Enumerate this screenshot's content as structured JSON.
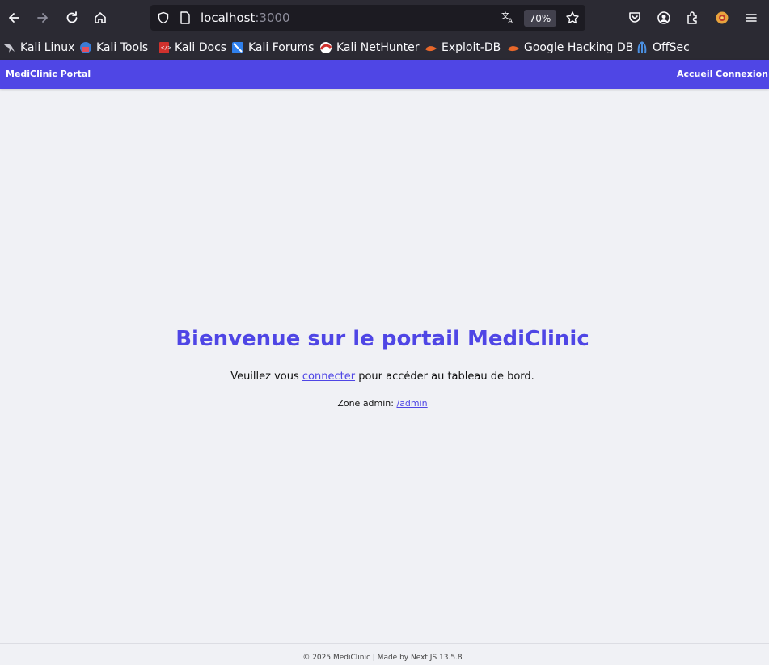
{
  "browser": {
    "url_host": "localhost",
    "url_port": ":3000",
    "zoom": "70%",
    "bookmarks": [
      {
        "label": "Kali Linux",
        "icon": "kali-dragon-icon"
      },
      {
        "label": "Kali Tools",
        "icon": "kali-tools-icon"
      },
      {
        "label": "Kali Docs",
        "icon": "kali-docs-icon"
      },
      {
        "label": "Kali Forums",
        "icon": "kali-forums-icon"
      },
      {
        "label": "Kali NetHunter",
        "icon": "nethunter-icon"
      },
      {
        "label": "Exploit-DB",
        "icon": "exploit-db-icon"
      },
      {
        "label": "Google Hacking DB",
        "icon": "ghdb-icon"
      },
      {
        "label": "OffSec",
        "icon": "offsec-icon"
      }
    ]
  },
  "app": {
    "brand": "MediClinic Portal",
    "nav": {
      "home": "Accueil",
      "login": "Connexion"
    },
    "accent_color": "#4f46e5"
  },
  "main": {
    "title": "Bienvenue sur le portail MediClinic",
    "intro_before": "Veuillez vous ",
    "intro_link": "connecter",
    "intro_after": " pour accéder au tableau de bord.",
    "admin_label": "Zone admin: ",
    "admin_link": "/admin"
  },
  "footer": {
    "text": "© 2025 MediClinic | Made by Next JS 13.5.8"
  }
}
